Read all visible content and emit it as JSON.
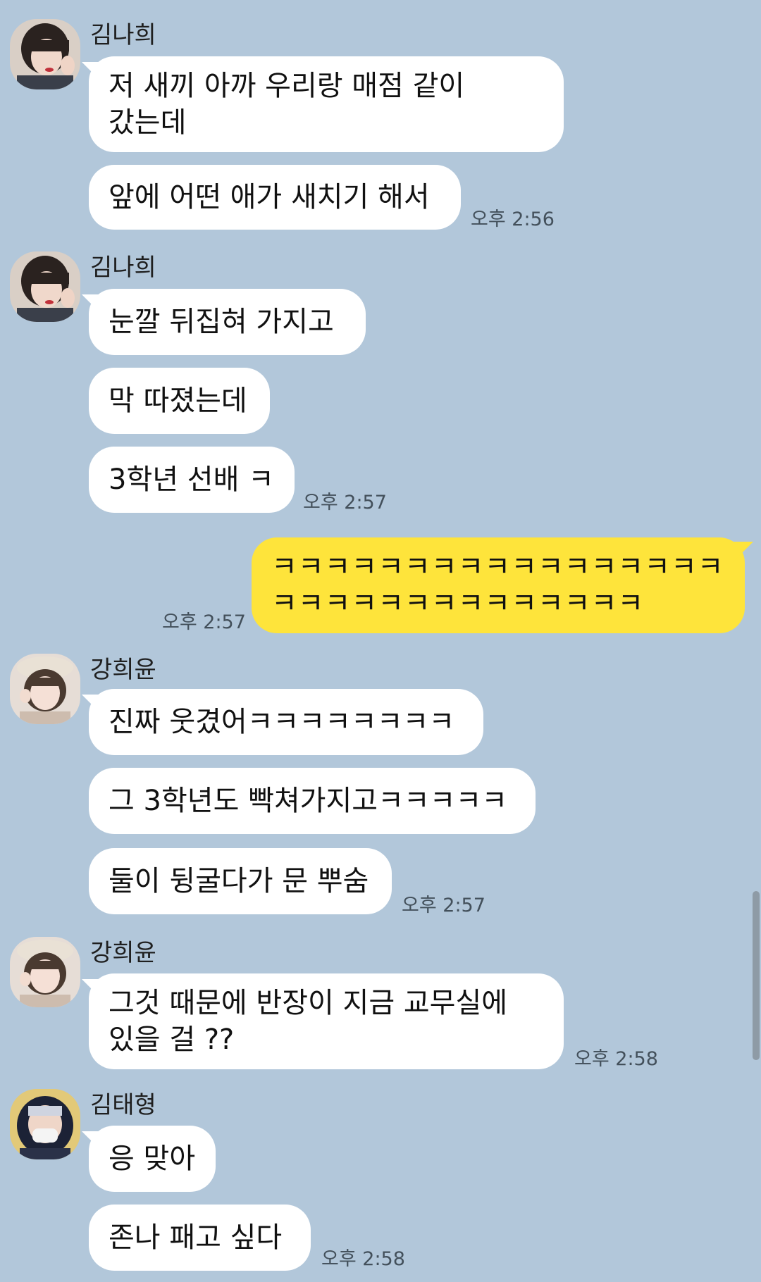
{
  "chat": {
    "groups": [
      {
        "sender": "김나희",
        "avatar": "girl-dark-hair-photo",
        "messages": [
          "저 새끼 아까 우리랑 매점 같이\n갔는데",
          "앞에 어떤 애가 새치기 해서"
        ],
        "time": "오후 2:56"
      },
      {
        "sender": "김나희",
        "avatar": "girl-dark-hair-photo",
        "messages": [
          "눈깔 뒤집혀 가지고",
          "막 따졌는데",
          "3학년 선배 ㅋ"
        ],
        "time": "오후 2:57"
      },
      {
        "sender": "me",
        "messages": [
          "ㅋㅋㅋㅋㅋㅋㅋㅋㅋㅋㅋㅋㅋㅋㅋㅋㅋ\nㅋㅋㅋㅋㅋㅋㅋㅋㅋㅋㅋㅋㅋㅋ"
        ],
        "time": "오후 2:57"
      },
      {
        "sender": "강희윤",
        "avatar": "girl-beret-photo",
        "messages": [
          "진짜 웃겼어ㅋㅋㅋㅋㅋㅋㅋㅋ",
          "그 3학년도 빡쳐가지고ㅋㅋㅋㅋㅋ",
          "둘이 뒹굴다가 문 뿌숨"
        ],
        "time": "오후 2:57"
      },
      {
        "sender": "강희윤",
        "avatar": "girl-beret-photo",
        "messages": [
          "그것 때문에 반장이 지금 교무실에\n있을 걸 ??"
        ],
        "time": "오후 2:58"
      },
      {
        "sender": "김태형",
        "avatar": "boy-mask-hood-photo",
        "messages": [
          "응 맞아",
          "존나 패고 싶다"
        ],
        "time": "오후 2:58"
      }
    ]
  },
  "colors": {
    "background": "#b2c7da",
    "incoming_bubble": "#ffffff",
    "outgoing_bubble": "#fee43b",
    "timestamp": "#43505b"
  }
}
